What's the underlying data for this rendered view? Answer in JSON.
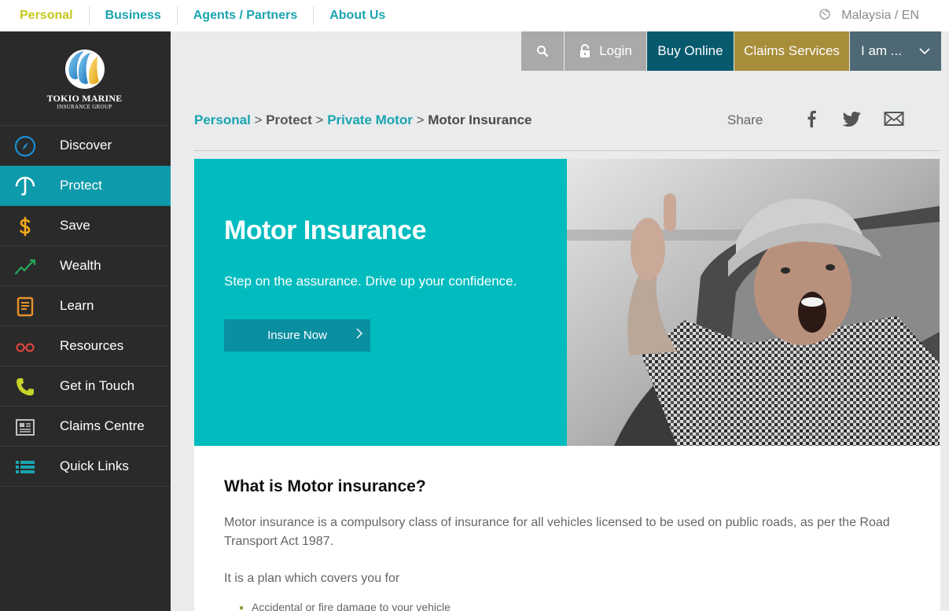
{
  "topnav": {
    "items": [
      {
        "label": "Personal",
        "active": true
      },
      {
        "label": "Business"
      },
      {
        "label": "Agents / Partners"
      },
      {
        "label": "About Us"
      }
    ],
    "region": "Malaysia / EN"
  },
  "logo": {
    "line1": "TOKIO MARINE",
    "line2": "INSURANCE GROUP"
  },
  "sidebar": {
    "items": [
      {
        "label": "Discover",
        "icon": "compass-icon"
      },
      {
        "label": "Protect",
        "icon": "umbrella-icon",
        "active": true
      },
      {
        "label": "Save",
        "icon": "dollar-icon"
      },
      {
        "label": "Wealth",
        "icon": "trend-up-icon"
      },
      {
        "label": "Learn",
        "icon": "book-icon"
      },
      {
        "label": "Resources",
        "icon": "glasses-icon"
      },
      {
        "label": "Get in Touch",
        "icon": "phone-icon"
      },
      {
        "label": "Claims Centre",
        "icon": "newspaper-icon"
      },
      {
        "label": "Quick Links",
        "icon": "list-icon"
      }
    ]
  },
  "actions": {
    "login": "Login",
    "buy_online": "Buy Online",
    "claims_services": "Claims Services",
    "iam": "I am ..."
  },
  "breadcrumb": {
    "items": [
      "Personal",
      "Protect",
      "Private Motor",
      "Motor Insurance"
    ],
    "separator": ">"
  },
  "share": {
    "label": "Share"
  },
  "hero": {
    "title": "Motor Insurance",
    "subtitle": "Step on the assurance. Drive up your confidence.",
    "button": "Insure Now"
  },
  "content": {
    "heading": "What is Motor insurance?",
    "para1": "Motor insurance is a compulsory class of insurance for all vehicles licensed to be used on public roads, as per the Road Transport Act 1987.",
    "para2": "It is a plan which covers you for",
    "list": [
      "Accidental or fire damage to your vehicle"
    ]
  },
  "colors": {
    "teal": "#00bcbf",
    "teal_dark": "#0d9aaa",
    "navy": "#075a6e",
    "gold": "#a88d3a",
    "active_nav": "#c8c81e"
  }
}
